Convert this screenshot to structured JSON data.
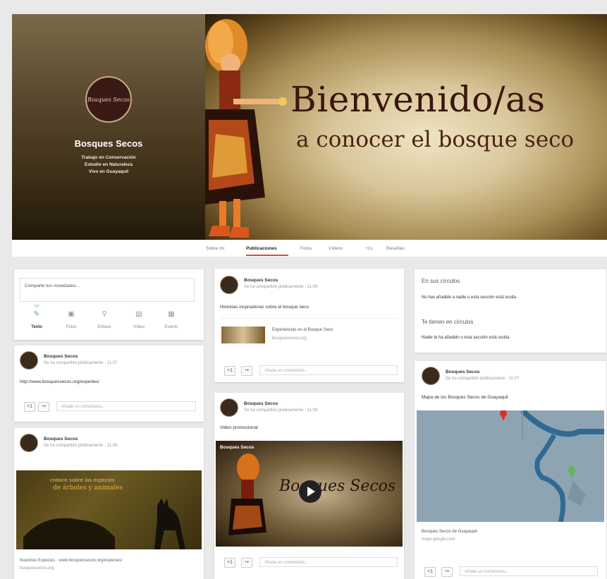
{
  "profile": {
    "logo_text": "Bosques Secos",
    "name": "Bosques Secos",
    "taglines": [
      "Trabajo en Conservación",
      "Estudio en Naturaleza",
      "Vivo en Guayaquil"
    ]
  },
  "banner": {
    "title": "Bienvenido/as",
    "subtitle": "a conocer el bosque seco"
  },
  "tabs": [
    "Sobre mí",
    "Publicaciones",
    "Fotos",
    "Vídeos",
    "+1s",
    "Reseñas"
  ],
  "active_tab": "Publicaciones",
  "share_box": {
    "placeholder": "Comparte tus novedades...",
    "actions": [
      {
        "label": "Texto",
        "icon": "pencil-icon"
      },
      {
        "label": "Fotos",
        "icon": "camera-icon"
      },
      {
        "label": "Enlace",
        "icon": "link-icon"
      },
      {
        "label": "Vídeo",
        "icon": "video-icon"
      },
      {
        "label": "Evento",
        "icon": "calendar-icon"
      }
    ]
  },
  "posts": [
    {
      "author": "Bosques Secos",
      "meta": "Se ha compartido públicamente · 11:07",
      "text": "http://www.bosquessecos.org/expertes/",
      "comment_placeholder": "Añade un comentario..."
    },
    {
      "author": "Bosques Secos",
      "meta": "Se ha compartido públicamente · 11:08",
      "image_title": "conoce sobre las especies",
      "image_subtitle": "de árboles y animales",
      "caption": "Nuestras Especies · www.bosquessecos.org/especies/",
      "caption_url": "bosquessecos.org"
    },
    {
      "author": "Bosques Secos",
      "meta": "Se ha compartido públicamente · 11:08",
      "text": "Historias inspiradoras sobre el bosque seco",
      "link_title": "Experiencias en el Bosque Seco",
      "link_url": "bosquessecos.org",
      "comment_placeholder": "Añade un comentario..."
    },
    {
      "author": "Bosques Secos",
      "meta": "Se ha compartido públicamente · 11:08",
      "text": "Video promocional",
      "video_label": "Bosques Secos",
      "video_title": "Bosques Secos",
      "comment_placeholder": "Añade un comentario..."
    },
    {
      "author": "Bosques Secos",
      "meta": "Se ha compartido públicamente · 11:07",
      "text": "Mapa de los Bosques Secos de Guayaquil",
      "map_title": "Bosques Secos de Guayaquil",
      "map_url": "maps.google.com",
      "comment_placeholder": "Añade un comentario..."
    }
  ],
  "circles": {
    "in_circles_title": "En sus círculos",
    "in_circles_text": "No has añadido a nadie o esta sección está oculta",
    "have_you_title": "Te tienen en círculos",
    "have_you_text": "Nadie te ha añadido o esta sección está oculta"
  },
  "colors": {
    "accent_tab": "#dd4b39",
    "map_water": "#4a7fa6",
    "map_land": "#8fa4b3",
    "marker_red": "#d9302c",
    "marker_green": "#5cb85c"
  }
}
